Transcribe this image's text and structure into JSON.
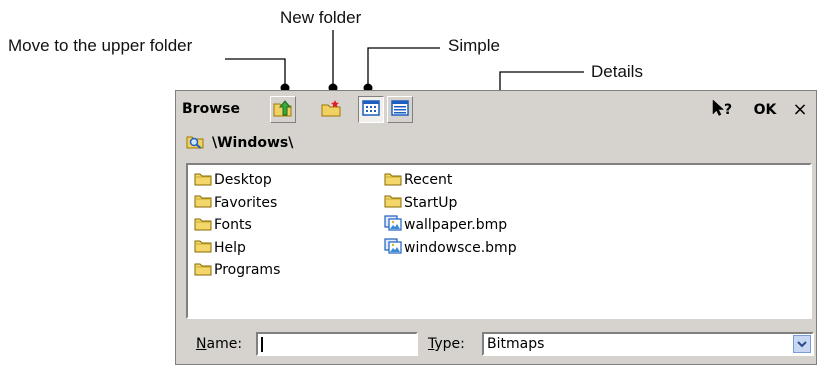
{
  "callouts": {
    "upper_folder": "Move to the upper folder",
    "new_folder": "New folder",
    "simple": "Simple",
    "details": "Details"
  },
  "dialog": {
    "title": "Browse",
    "help_icon": "help-cursor-icon",
    "ok_label": "OK",
    "close_label": "×",
    "path": "\\Windows\\",
    "left_column": [
      {
        "name": "Desktop",
        "icon": "folder-icon"
      },
      {
        "name": "Favorites",
        "icon": "folder-icon"
      },
      {
        "name": "Fonts",
        "icon": "folder-icon"
      },
      {
        "name": "Help",
        "icon": "folder-icon"
      },
      {
        "name": "Programs",
        "icon": "folder-icon"
      }
    ],
    "right_column": [
      {
        "name": "Recent",
        "icon": "folder-icon"
      },
      {
        "name": "StartUp",
        "icon": "folder-icon"
      },
      {
        "name": "wallpaper.bmp",
        "icon": "bitmap-file-icon"
      },
      {
        "name": "windowsce.bmp",
        "icon": "bitmap-file-icon"
      }
    ],
    "name_label_accel": "N",
    "name_label_rest": "ame:",
    "name_value": "",
    "type_label_accel": "T",
    "type_label_rest": "ype:",
    "type_value": "Bitmaps"
  }
}
